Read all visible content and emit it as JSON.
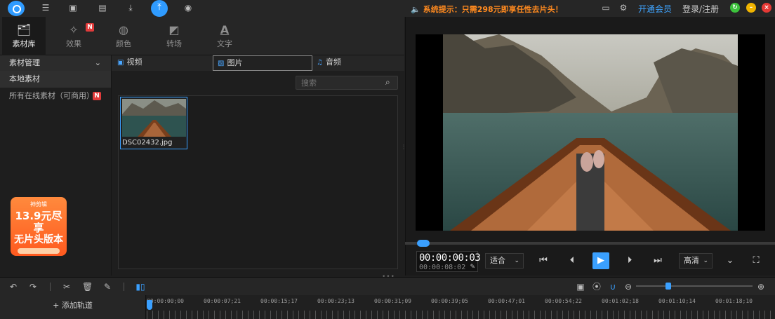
{
  "topbar": {
    "notice": "系统提示：只需298元即享任性去片头！",
    "member_link": "开通会员",
    "login_link": "登录/注册"
  },
  "left_tabs": [
    {
      "label": "素材库",
      "icon": "library-icon"
    },
    {
      "label": "效果",
      "icon": "magic-wand-icon",
      "badge": "N"
    },
    {
      "label": "颜色",
      "icon": "palette-icon"
    },
    {
      "label": "转场",
      "icon": "transition-icon"
    },
    {
      "label": "文字",
      "icon": "text-icon"
    }
  ],
  "sidebar": {
    "header": "素材管理",
    "items": [
      "本地素材",
      "所有在线素材（可商用）"
    ],
    "online_badge": "N",
    "promo": {
      "top": "神剪辑",
      "line1": "13.9元尽享",
      "line2": "无片头版本"
    }
  },
  "media_tabs": [
    "视频",
    "图片",
    "音频"
  ],
  "search": {
    "placeholder": "搜索"
  },
  "media_items": [
    {
      "filename": "DSC02432.jpg"
    }
  ],
  "preview": {
    "current_time": "00:00:00:03",
    "total_time": "00:00:08:02",
    "fit_option": "适合",
    "quality_option": "高清",
    "progress_fraction": 0.02
  },
  "timeline": {
    "add_track": "+ 添加轨道",
    "ruler_labels": [
      "00:00:00;00",
      "00:00:07;21",
      "00:00:15;17",
      "00:00:23;13",
      "00:00:31;09",
      "00:00:39;05",
      "00:00:47;01",
      "00:00:54;22",
      "00:01:02;18",
      "00:01:10;14",
      "00:01:18;10"
    ],
    "zoom_fraction": 0.25
  },
  "colors": {
    "accent": "#3aa0ff",
    "notice": "#ff8a1f"
  }
}
